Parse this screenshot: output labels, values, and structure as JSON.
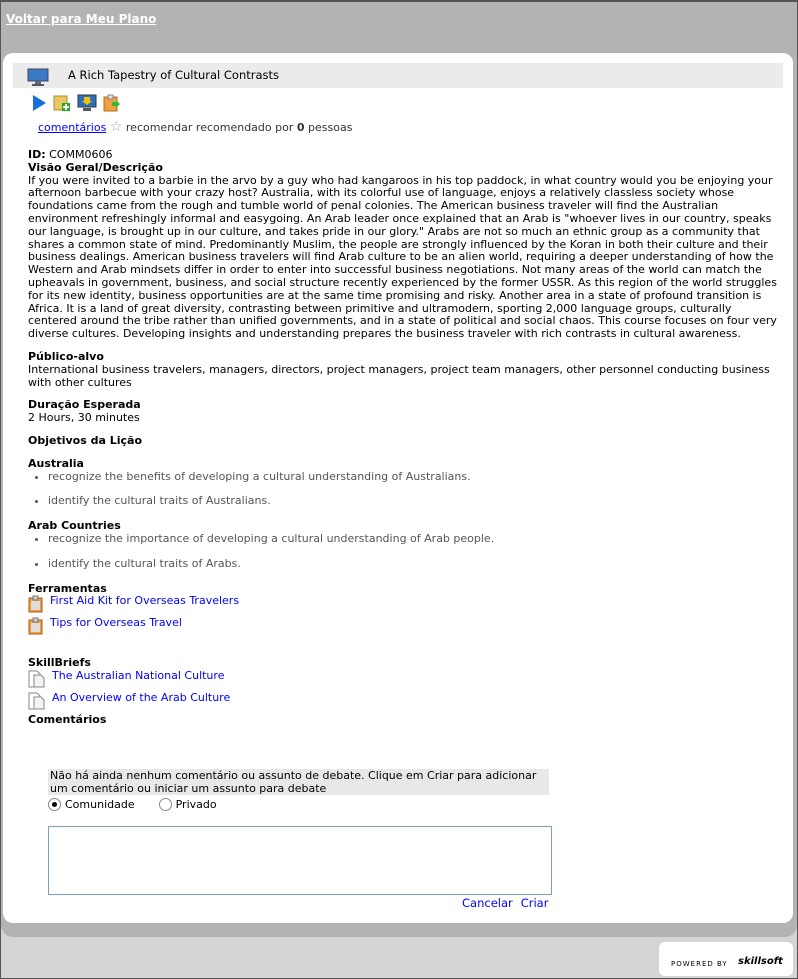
{
  "nav": {
    "back_label": "Voltar para Meu Plano"
  },
  "course": {
    "title": "A Rich Tapestry of Cultural Contrasts",
    "icons": [
      "play-icon",
      "add-to-plan-icon",
      "download-icon",
      "export-icon"
    ]
  },
  "social": {
    "comments_link": "comentários",
    "recommend_label": "recomendar",
    "recommended_by": "recomendado por",
    "count": "0",
    "people": "pessoas"
  },
  "details": {
    "id_label": "ID:",
    "id_value": "COMM0606",
    "overview_heading": "Visão Geral/Descrição",
    "overview": "If you were invited to a barbie in the arvo by a guy who had kangaroos in his top paddock, in what country would you be enjoying your afternoon barbecue with your crazy host? Australia, with its colorful use of language, enjoys a relatively classless society whose foundations came from the rough and tumble world of penal colonies. The American business traveler will find the Australian environment refreshingly informal and easygoing. An Arab leader once explained that an Arab is \"whoever lives in our country, speaks our language, is brought up in our culture, and takes pride in our glory.\" Arabs are not so much an ethnic group as a community that shares a common state of mind. Predominantly Muslim, the people are strongly influenced by the Koran in both their culture and their business dealings. American business travelers will find Arab culture to be an alien world, requiring a deeper understanding of how the Western and Arab mindsets differ in order to enter into successful business negotiations. Not many areas of the world can match the upheavals in government, business, and social structure recently experienced by the former USSR. As this region of the world struggles for its new identity, business opportunities are at the same time promising and risky. Another area in a state of profound transition is Africa. It is a land of great diversity, contrasting between primitive and ultramodern, sporting 2,000 language groups, culturally centered around the tribe rather than unified governments, and in a state of political and social chaos. This course focuses on four very diverse cultures. Developing insights and understanding prepares the business traveler with rich contrasts in cultural awareness.",
    "audience_heading": "Público-alvo",
    "audience": "International business travelers, managers, directors, project managers, project team managers, other personnel conducting business with other cultures",
    "duration_heading": "Duração Esperada",
    "duration": "2 Hours, 30 minutes",
    "objectives_heading": "Objetivos da Lição",
    "objective_groups": [
      {
        "title": "Australia",
        "items": [
          "recognize the benefits of developing a cultural understanding of Australians.",
          "identify the cultural traits of Australians."
        ]
      },
      {
        "title": "Arab Countries",
        "items": [
          "recognize the importance of developing a cultural understanding of Arab people.",
          "identify the cultural traits of Arabs."
        ]
      }
    ],
    "tools_heading": "Ferramentas",
    "tools": [
      "First Aid Kit for Overseas Travelers",
      "Tips for Overseas Travel"
    ],
    "skillbriefs_heading": "SkillBriefs",
    "skillbriefs": [
      "The Australian National Culture",
      "An Overview of the Arab Culture"
    ],
    "comments_heading": "Comentários"
  },
  "comments": {
    "message": "Não há ainda nenhum comentário ou assunto de debate. Clique em Criar para adicionar um comentário ou iniciar um assunto para debate",
    "option_community": "Comunidade",
    "option_private": "Privado",
    "selected": "Comunidade",
    "text_value": "",
    "cancel_label": "Cancelar",
    "create_label": "Criar"
  },
  "footer": {
    "powered_by": "POWERED BY",
    "brand": "skillsoft"
  }
}
